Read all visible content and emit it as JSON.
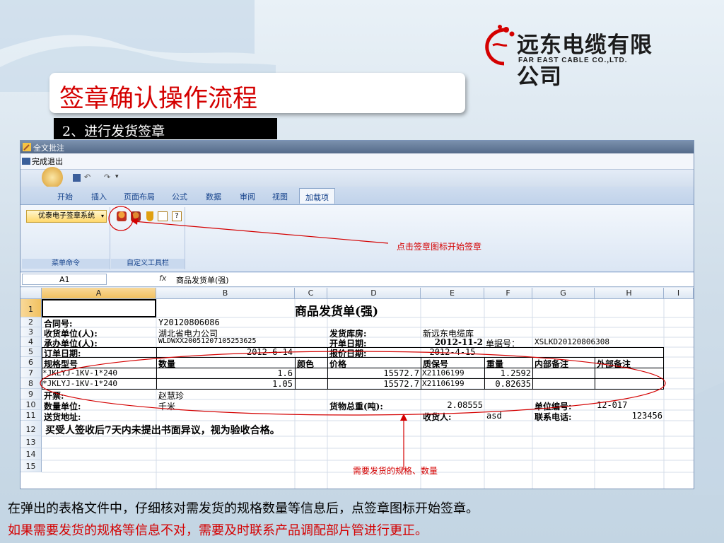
{
  "slide": {
    "logo": {
      "cn": "远东电缆有限公司",
      "en": "FAR EAST CABLE CO.,LTD."
    },
    "title": "签章确认操作流程",
    "subtitle": "2、进行发货签章",
    "footer_line1": "在弹出的表格文件中，仔细核对需发货的规格数量等信息后，点签章图标开始签章。",
    "footer_line2": "如果需要发货的规格等信息不对，需要及时联系产品调配部片管进行更正。",
    "colors": {
      "accent_red": "#d40000",
      "ribbon_blue": "#15428b"
    }
  },
  "window": {
    "title": "全文批注",
    "finish_button": "完成退出",
    "qat_dropdown": "▾",
    "tabs": [
      "开始",
      "插入",
      "页面布局",
      "公式",
      "数据",
      "审阅",
      "视图",
      "加载项"
    ],
    "active_tab": "加载项",
    "ribbon": {
      "dropdown_label": "优泰电子签章系统",
      "group1_label": "菜单命令",
      "group2_label": "自定义工具栏",
      "icons": [
        "stamp-icon",
        "stamp-multi-icon",
        "shield-icon",
        "table-icon",
        "help-icon"
      ],
      "help_glyph": "?"
    },
    "formula_bar": {
      "name_box": "A1",
      "fx": "fx",
      "content": "商品发货单(强)"
    }
  },
  "sheet": {
    "columns": [
      "A",
      "B",
      "C",
      "D",
      "E",
      "F",
      "G",
      "H",
      "I"
    ],
    "rows": [
      "1",
      "2",
      "3",
      "4",
      "5",
      "6",
      "7",
      "8",
      "9",
      "10",
      "11",
      "12",
      "13",
      "14",
      "15"
    ],
    "r1": {
      "D": "商品发货单(强)"
    },
    "r2": {
      "A": "合同号:",
      "B": "Y20120806086"
    },
    "r3": {
      "A": "收货单位(人):",
      "B": "湖北省电力公司",
      "D": "发货库房:",
      "E": "新远东电缆库"
    },
    "r4": {
      "A": "承办单位(人):",
      "B": "WLDWXX20051207105253625",
      "D": "开单日期:",
      "E": "2012-11-2",
      "F": "单据号：",
      "G": "XSLKD20120806308"
    },
    "r5": {
      "A": "订单日期:",
      "B": "2012-6-14",
      "D": "报价日期:",
      "E": "2012-4-15"
    },
    "r6": {
      "A": "规格型号",
      "B": "数量",
      "C": "颜色",
      "D": "价格",
      "E": "质保号",
      "F": "重量",
      "G": "内部备注",
      "H": "外部备注"
    },
    "r7": {
      "A": "*JKLYJ-1KV-1*240",
      "B": "1.6",
      "D": "15572.7",
      "E": "X21106199",
      "F": "1.2592"
    },
    "r8": {
      "A": "*JKLYJ-1KV-1*240",
      "B": "1.05",
      "D": "15572.7",
      "E": "X21106199",
      "F": "0.82635"
    },
    "r9": {
      "A": "开票:",
      "B": "赵慧珍"
    },
    "r10": {
      "A": "数量单位:",
      "B": "千米",
      "D": "货物总重(吨):",
      "E": "2.08555",
      "G": "单位编号:",
      "H": "12-017"
    },
    "r11": {
      "A": "送货地址:",
      "E": "收货人:",
      "F": "asd",
      "G": "联系电话:",
      "H": "123456"
    },
    "r12": {
      "A": "买受人签收后7天内未提出书面异议，视为验收合格。"
    }
  },
  "annotations": {
    "click_stamp": "点击签章图标开始签章",
    "spec_qty": "需要发货的规格、数量"
  }
}
